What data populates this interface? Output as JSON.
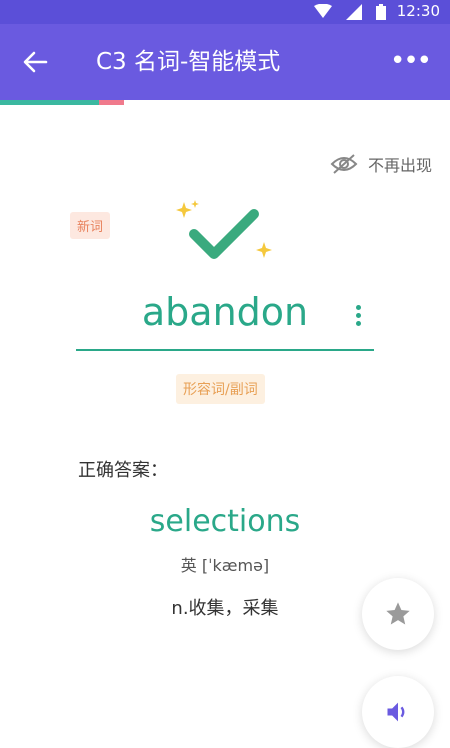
{
  "status_bar": {
    "time": "12:30"
  },
  "app_bar": {
    "title": "C3 名词-智能模式",
    "more_label": "•••"
  },
  "progress": {
    "done_fraction": 0.22,
    "current_fraction": 0.055,
    "done_color": "#3bb8a0",
    "current_color": "#f07a8c"
  },
  "hide_action": {
    "label": "不再出现",
    "icon": "eye-off-icon"
  },
  "word_card": {
    "badge": "新词",
    "result_icon": "checkmark-icon",
    "word": "abandon",
    "part_of_speech": "形容词/副词"
  },
  "answer": {
    "label": "正确答案：",
    "word": "selections",
    "phonetic": "英 [ˈkæmə]",
    "meaning": "n.收集，采集"
  },
  "actions": {
    "favorite_icon": "star-icon",
    "sound_icon": "speaker-icon"
  },
  "colors": {
    "primary": "#6a5ae0",
    "accent": "#2aa889"
  }
}
